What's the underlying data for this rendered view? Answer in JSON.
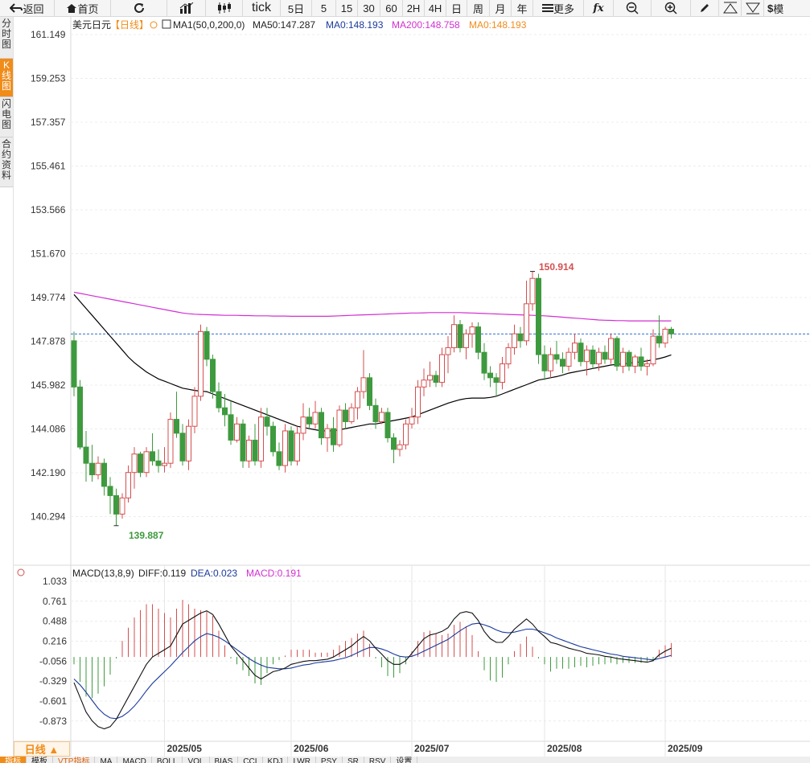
{
  "toolbar": {
    "back": "返回",
    "home": "首页",
    "tick": "tick",
    "fiveday": "5日",
    "m5": "5",
    "m15": "15",
    "m30": "30",
    "m60": "60",
    "h2": "2H",
    "h4": "4H",
    "day": "日",
    "week": "周",
    "month": "月",
    "year": "年",
    "more": "更多",
    "last": "模"
  },
  "side_tabs": [
    "分时图",
    "K线图",
    "闪电图",
    "合约资料"
  ],
  "header": {
    "symbol": "美元日元",
    "period_tag": "【日线】",
    "ma_label": "MA1(50,0,200,0)",
    "ma50": "MA50:147.287",
    "ma0a": "MA0:148.193",
    "ma200": "MA200:148.758",
    "ma0b": "MA0:148.193"
  },
  "macd_header": {
    "label": "MACD(13,8,9)",
    "diff": "DIFF:0.119",
    "dea": "DEA:0.023",
    "macd": "MACD:0.191"
  },
  "period_button": "日线 ▲",
  "bottom_tabs": [
    "指标",
    "模板",
    "VTP指标",
    "MA",
    "MACD",
    "BOLL",
    "VOL",
    "BIAS",
    "CCI",
    "KDJ",
    "LWR",
    "PSY",
    "SR",
    "RSV",
    "设置"
  ],
  "colors": {
    "up": "#d44f4f",
    "down": "#3e9a3e",
    "ma50": "#000000",
    "ma200": "#d22fd2",
    "price_line": "#2f6fd6",
    "accent": "#f08c1a"
  },
  "chart_data": [
    {
      "type": "candlestick",
      "title": "美元日元【日线】",
      "y_ticks": [
        161.149,
        159.253,
        157.357,
        155.461,
        153.566,
        151.67,
        149.774,
        147.878,
        145.982,
        144.086,
        142.19,
        140.294
      ],
      "ylim": [
        139.2,
        161.6
      ],
      "x_ticks": [
        "2025/05",
        "2025/06",
        "2025/07",
        "2025/08",
        "2025/09"
      ],
      "current_price": 148.193,
      "max_label": "150.914",
      "min_label": "139.887",
      "ohlc": [
        [
          147.9,
          148.3,
          145.5,
          145.9
        ],
        [
          145.9,
          146.2,
          143.2,
          143.3
        ],
        [
          143.3,
          144.0,
          141.8,
          142.6
        ],
        [
          142.6,
          143.4,
          141.8,
          142.1
        ],
        [
          142.1,
          142.9,
          141.9,
          142.6
        ],
        [
          142.6,
          142.8,
          141.2,
          141.6
        ],
        [
          141.6,
          142.0,
          140.4,
          141.2
        ],
        [
          141.2,
          141.5,
          139.9,
          140.4
        ],
        [
          140.4,
          141.3,
          140.2,
          141.1
        ],
        [
          141.1,
          142.5,
          140.9,
          142.2
        ],
        [
          142.2,
          143.3,
          141.5,
          143.0
        ],
        [
          143.0,
          143.1,
          142.0,
          142.2
        ],
        [
          142.2,
          143.3,
          142.0,
          143.1
        ],
        [
          143.1,
          143.9,
          142.5,
          142.7
        ],
        [
          142.7,
          143.2,
          142.2,
          142.5
        ],
        [
          142.5,
          143.3,
          142.2,
          142.6
        ],
        [
          142.6,
          144.8,
          142.4,
          144.5
        ],
        [
          144.5,
          145.7,
          143.7,
          143.9
        ],
        [
          143.9,
          144.3,
          142.5,
          142.7
        ],
        [
          142.7,
          144.5,
          142.3,
          144.2
        ],
        [
          144.2,
          145.9,
          143.9,
          145.5
        ],
        [
          145.5,
          148.6,
          145.3,
          148.3
        ],
        [
          148.3,
          148.5,
          146.8,
          147.1
        ],
        [
          147.1,
          147.3,
          145.4,
          145.7
        ],
        [
          145.7,
          146.1,
          144.8,
          145.0
        ],
        [
          145.0,
          145.6,
          144.2,
          144.7
        ],
        [
          144.7,
          145.3,
          143.4,
          143.6
        ],
        [
          143.6,
          144.6,
          143.5,
          144.3
        ],
        [
          144.3,
          144.5,
          142.4,
          142.7
        ],
        [
          142.7,
          143.8,
          142.4,
          143.6
        ],
        [
          143.6,
          144.3,
          142.5,
          142.7
        ],
        [
          142.7,
          145.0,
          142.4,
          144.6
        ],
        [
          144.6,
          145.0,
          143.8,
          144.2
        ],
        [
          144.2,
          144.4,
          142.9,
          143.1
        ],
        [
          143.1,
          143.5,
          142.3,
          142.5
        ],
        [
          142.5,
          144.3,
          142.2,
          144.0
        ],
        [
          144.0,
          144.2,
          142.5,
          142.7
        ],
        [
          142.7,
          144.2,
          142.5,
          143.9
        ],
        [
          143.9,
          145.2,
          143.6,
          144.6
        ],
        [
          144.6,
          145.0,
          144.1,
          144.3
        ],
        [
          144.3,
          145.3,
          144.1,
          144.8
        ],
        [
          144.8,
          145.0,
          143.4,
          143.7
        ],
        [
          143.7,
          144.3,
          143.1,
          144.1
        ],
        [
          144.1,
          144.6,
          143.1,
          143.4
        ],
        [
          143.4,
          145.1,
          143.3,
          144.9
        ],
        [
          144.9,
          145.2,
          144.1,
          144.4
        ],
        [
          144.4,
          145.2,
          144.3,
          145.0
        ],
        [
          145.0,
          145.9,
          144.5,
          145.7
        ],
        [
          145.7,
          147.5,
          145.4,
          146.3
        ],
        [
          146.3,
          146.5,
          144.9,
          145.1
        ],
        [
          145.1,
          145.4,
          144.1,
          144.4
        ],
        [
          144.4,
          145.0,
          144.3,
          144.8
        ],
        [
          144.8,
          145.0,
          143.5,
          143.7
        ],
        [
          143.7,
          143.9,
          142.6,
          143.2
        ],
        [
          143.2,
          143.6,
          142.9,
          143.4
        ],
        [
          143.4,
          144.5,
          143.2,
          144.3
        ],
        [
          144.3,
          145.0,
          144.1,
          144.6
        ],
        [
          144.6,
          146.2,
          144.3,
          145.9
        ],
        [
          145.9,
          146.7,
          145.5,
          146.2
        ],
        [
          146.2,
          147.0,
          145.9,
          146.4
        ],
        [
          146.4,
          146.6,
          145.9,
          146.1
        ],
        [
          146.1,
          147.6,
          145.9,
          147.3
        ],
        [
          147.3,
          148.1,
          146.5,
          147.6
        ],
        [
          147.6,
          149.0,
          147.4,
          148.6
        ],
        [
          148.6,
          148.8,
          147.4,
          147.6
        ],
        [
          147.6,
          148.4,
          147.1,
          148.2
        ],
        [
          148.2,
          148.7,
          147.6,
          148.5
        ],
        [
          148.5,
          148.7,
          147.1,
          147.4
        ],
        [
          147.4,
          147.8,
          146.2,
          146.5
        ],
        [
          146.5,
          146.8,
          145.9,
          146.3
        ],
        [
          146.3,
          146.5,
          145.5,
          146.1
        ],
        [
          146.1,
          147.2,
          145.8,
          146.9
        ],
        [
          146.9,
          147.8,
          146.7,
          147.6
        ],
        [
          147.6,
          148.6,
          147.3,
          148.2
        ],
        [
          148.2,
          148.5,
          147.6,
          147.9
        ],
        [
          147.9,
          150.5,
          147.7,
          149.5
        ],
        [
          149.5,
          150.9,
          149.2,
          150.6
        ],
        [
          150.6,
          150.8,
          146.9,
          147.3
        ],
        [
          147.3,
          147.7,
          146.2,
          146.6
        ],
        [
          146.6,
          147.6,
          146.3,
          147.3
        ],
        [
          147.3,
          147.9,
          146.9,
          147.1
        ],
        [
          147.1,
          147.4,
          146.5,
          146.8
        ],
        [
          146.8,
          147.6,
          146.6,
          147.4
        ],
        [
          147.4,
          148.2,
          147.1,
          147.8
        ],
        [
          147.8,
          148.0,
          146.8,
          147.0
        ],
        [
          147.0,
          147.7,
          146.4,
          147.5
        ],
        [
          147.5,
          147.7,
          146.7,
          146.9
        ],
        [
          146.9,
          147.6,
          146.6,
          147.4
        ],
        [
          147.4,
          147.7,
          146.9,
          147.1
        ],
        [
          147.1,
          148.2,
          146.9,
          148.0
        ],
        [
          148.0,
          148.1,
          146.6,
          146.8
        ],
        [
          146.8,
          147.6,
          146.5,
          147.4
        ],
        [
          147.4,
          147.5,
          146.6,
          146.8
        ],
        [
          146.8,
          147.3,
          146.5,
          147.2
        ],
        [
          147.2,
          147.6,
          146.6,
          146.8
        ],
        [
          146.8,
          147.1,
          146.4,
          146.9
        ],
        [
          146.9,
          148.4,
          146.8,
          148.1
        ],
        [
          148.1,
          149.0,
          147.6,
          147.8
        ],
        [
          147.8,
          148.5,
          147.6,
          148.4
        ],
        [
          148.4,
          148.5,
          148.0,
          148.2
        ]
      ],
      "ma50": [
        149.9,
        149.6,
        149.3,
        149.0,
        148.7,
        148.4,
        148.1,
        147.8,
        147.5,
        147.2,
        146.95,
        146.75,
        146.55,
        146.4,
        146.25,
        146.15,
        146.05,
        145.95,
        145.85,
        145.8,
        145.75,
        145.72,
        145.7,
        145.6,
        145.5,
        145.4,
        145.3,
        145.2,
        145.1,
        145.0,
        144.9,
        144.8,
        144.7,
        144.6,
        144.5,
        144.4,
        144.3,
        144.2,
        144.15,
        144.1,
        144.05,
        144.0,
        144.0,
        144.0,
        144.05,
        144.1,
        144.15,
        144.2,
        144.25,
        144.3,
        144.3,
        144.35,
        144.4,
        144.45,
        144.5,
        144.55,
        144.6,
        144.7,
        144.8,
        144.9,
        145.0,
        145.1,
        145.2,
        145.28,
        145.35,
        145.4,
        145.42,
        145.42,
        145.42,
        145.45,
        145.5,
        145.6,
        145.7,
        145.8,
        145.9,
        146.0,
        146.1,
        146.2,
        146.25,
        146.3,
        146.35,
        146.42,
        146.5,
        146.55,
        146.6,
        146.65,
        146.7,
        146.75,
        146.8,
        146.85,
        146.88,
        146.9,
        146.93,
        146.96,
        146.99,
        147.03,
        147.08,
        147.13,
        147.2,
        147.29
      ],
      "ma200": [
        150.0,
        149.95,
        149.9,
        149.85,
        149.8,
        149.75,
        149.7,
        149.65,
        149.6,
        149.55,
        149.5,
        149.45,
        149.4,
        149.35,
        149.3,
        149.25,
        149.2,
        149.15,
        149.1,
        149.07,
        149.05,
        149.04,
        149.03,
        149.02,
        149.01,
        149.0,
        149.0,
        149.0,
        148.99,
        148.99,
        148.98,
        148.98,
        148.98,
        148.97,
        148.97,
        148.97,
        148.96,
        148.96,
        148.96,
        148.96,
        148.96,
        148.96,
        148.96,
        148.97,
        148.98,
        148.99,
        149.0,
        149.01,
        149.02,
        149.03,
        149.04,
        149.05,
        149.06,
        149.07,
        149.08,
        149.09,
        149.1,
        149.1,
        149.11,
        149.12,
        149.12,
        149.12,
        149.12,
        149.12,
        149.12,
        149.11,
        149.1,
        149.09,
        149.08,
        149.07,
        149.06,
        149.05,
        149.04,
        149.03,
        149.02,
        149.01,
        149.0,
        148.99,
        148.98,
        148.96,
        148.94,
        148.92,
        148.9,
        148.88,
        148.86,
        148.84,
        148.82,
        148.8,
        148.79,
        148.78,
        148.77,
        148.77,
        148.76,
        148.76,
        148.76,
        148.76,
        148.76,
        148.76,
        148.76,
        148.76
      ]
    },
    {
      "type": "macd",
      "title": "MACD(13,8,9)",
      "y_ticks": [
        1.033,
        0.761,
        0.488,
        0.216,
        -0.056,
        -0.329,
        -0.601,
        -0.873
      ],
      "ylim": [
        -1.05,
        1.1
      ],
      "diff": [
        -0.35,
        -0.55,
        -0.75,
        -0.87,
        -0.95,
        -0.98,
        -0.95,
        -0.85,
        -0.7,
        -0.55,
        -0.4,
        -0.25,
        -0.1,
        0.0,
        0.05,
        0.1,
        0.15,
        0.3,
        0.45,
        0.5,
        0.55,
        0.6,
        0.63,
        0.58,
        0.45,
        0.3,
        0.15,
        0.05,
        -0.05,
        -0.15,
        -0.25,
        -0.3,
        -0.25,
        -0.2,
        -0.18,
        -0.15,
        -0.1,
        -0.08,
        -0.06,
        -0.05,
        -0.05,
        -0.04,
        -0.03,
        0.0,
        0.05,
        0.1,
        0.15,
        0.22,
        0.28,
        0.22,
        0.12,
        0.04,
        -0.05,
        -0.1,
        -0.1,
        -0.05,
        0.05,
        0.15,
        0.25,
        0.3,
        0.32,
        0.35,
        0.4,
        0.52,
        0.6,
        0.62,
        0.6,
        0.5,
        0.35,
        0.25,
        0.2,
        0.2,
        0.28,
        0.38,
        0.45,
        0.52,
        0.45,
        0.35,
        0.28,
        0.2,
        0.18,
        0.15,
        0.12,
        0.1,
        0.08,
        0.05,
        0.04,
        0.03,
        0.01,
        0.0,
        -0.02,
        -0.03,
        -0.04,
        -0.05,
        -0.06,
        -0.07,
        -0.05,
        0.03,
        0.08,
        0.119
      ],
      "dea": [
        -0.3,
        -0.38,
        -0.48,
        -0.59,
        -0.7,
        -0.78,
        -0.83,
        -0.84,
        -0.81,
        -0.75,
        -0.67,
        -0.57,
        -0.46,
        -0.36,
        -0.28,
        -0.2,
        -0.12,
        -0.03,
        0.06,
        0.14,
        0.22,
        0.28,
        0.32,
        0.3,
        0.27,
        0.22,
        0.16,
        0.1,
        0.04,
        -0.02,
        -0.07,
        -0.11,
        -0.14,
        -0.15,
        -0.16,
        -0.16,
        -0.15,
        -0.13,
        -0.11,
        -0.1,
        -0.08,
        -0.07,
        -0.06,
        -0.05,
        -0.03,
        -0.01,
        0.02,
        0.06,
        0.1,
        0.13,
        0.13,
        0.11,
        0.08,
        0.04,
        0.01,
        0.0,
        0.01,
        0.04,
        0.08,
        0.12,
        0.16,
        0.2,
        0.24,
        0.3,
        0.36,
        0.41,
        0.45,
        0.46,
        0.44,
        0.41,
        0.37,
        0.34,
        0.33,
        0.34,
        0.36,
        0.38,
        0.38,
        0.36,
        0.33,
        0.3,
        0.26,
        0.23,
        0.2,
        0.17,
        0.14,
        0.12,
        0.1,
        0.08,
        0.06,
        0.04,
        0.03,
        0.01,
        0.0,
        -0.01,
        -0.02,
        -0.03,
        -0.04,
        -0.02,
        0.0,
        0.023
      ],
      "macd": [
        -0.1,
        -0.34,
        -0.54,
        -0.56,
        -0.5,
        -0.4,
        -0.24,
        -0.02,
        0.22,
        0.4,
        0.54,
        0.64,
        0.72,
        0.72,
        0.66,
        0.6,
        0.54,
        0.66,
        0.78,
        0.72,
        0.66,
        0.64,
        0.62,
        0.56,
        0.36,
        0.16,
        -0.02,
        -0.1,
        -0.18,
        -0.26,
        -0.36,
        -0.38,
        -0.22,
        -0.1,
        -0.04,
        0.02,
        0.1,
        0.1,
        0.1,
        0.1,
        0.06,
        0.06,
        0.06,
        0.1,
        0.16,
        0.22,
        0.26,
        0.32,
        0.36,
        0.18,
        -0.02,
        -0.14,
        -0.26,
        -0.28,
        -0.22,
        -0.1,
        0.08,
        0.22,
        0.34,
        0.36,
        0.32,
        0.3,
        0.32,
        0.44,
        0.48,
        0.42,
        0.3,
        0.08,
        -0.18,
        -0.32,
        -0.34,
        -0.28,
        -0.1,
        0.08,
        0.18,
        0.28,
        0.14,
        -0.02,
        -0.1,
        -0.2,
        -0.16,
        -0.16,
        -0.16,
        -0.14,
        -0.12,
        -0.14,
        -0.12,
        -0.1,
        -0.1,
        -0.08,
        -0.1,
        -0.08,
        -0.08,
        -0.08,
        -0.08,
        -0.06,
        -0.06,
        0.1,
        0.16,
        0.191
      ]
    }
  ]
}
